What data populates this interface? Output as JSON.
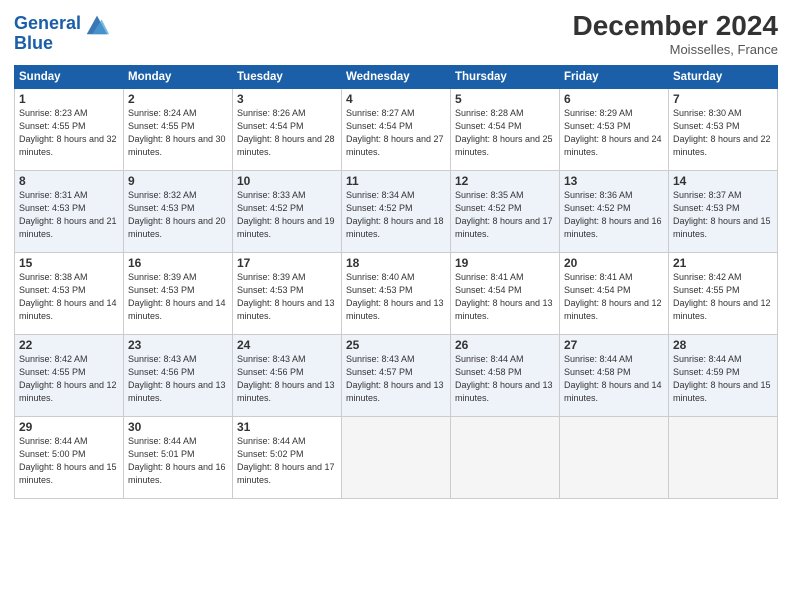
{
  "header": {
    "logo_line1": "General",
    "logo_line2": "Blue",
    "month": "December 2024",
    "location": "Moisselles, France"
  },
  "days_of_week": [
    "Sunday",
    "Monday",
    "Tuesday",
    "Wednesday",
    "Thursday",
    "Friday",
    "Saturday"
  ],
  "weeks": [
    [
      {
        "num": "1",
        "sunrise": "8:23 AM",
        "sunset": "4:55 PM",
        "daylight": "8 hours and 32 minutes."
      },
      {
        "num": "2",
        "sunrise": "8:24 AM",
        "sunset": "4:55 PM",
        "daylight": "8 hours and 30 minutes."
      },
      {
        "num": "3",
        "sunrise": "8:26 AM",
        "sunset": "4:54 PM",
        "daylight": "8 hours and 28 minutes."
      },
      {
        "num": "4",
        "sunrise": "8:27 AM",
        "sunset": "4:54 PM",
        "daylight": "8 hours and 27 minutes."
      },
      {
        "num": "5",
        "sunrise": "8:28 AM",
        "sunset": "4:54 PM",
        "daylight": "8 hours and 25 minutes."
      },
      {
        "num": "6",
        "sunrise": "8:29 AM",
        "sunset": "4:53 PM",
        "daylight": "8 hours and 24 minutes."
      },
      {
        "num": "7",
        "sunrise": "8:30 AM",
        "sunset": "4:53 PM",
        "daylight": "8 hours and 22 minutes."
      }
    ],
    [
      {
        "num": "8",
        "sunrise": "8:31 AM",
        "sunset": "4:53 PM",
        "daylight": "8 hours and 21 minutes."
      },
      {
        "num": "9",
        "sunrise": "8:32 AM",
        "sunset": "4:53 PM",
        "daylight": "8 hours and 20 minutes."
      },
      {
        "num": "10",
        "sunrise": "8:33 AM",
        "sunset": "4:52 PM",
        "daylight": "8 hours and 19 minutes."
      },
      {
        "num": "11",
        "sunrise": "8:34 AM",
        "sunset": "4:52 PM",
        "daylight": "8 hours and 18 minutes."
      },
      {
        "num": "12",
        "sunrise": "8:35 AM",
        "sunset": "4:52 PM",
        "daylight": "8 hours and 17 minutes."
      },
      {
        "num": "13",
        "sunrise": "8:36 AM",
        "sunset": "4:52 PM",
        "daylight": "8 hours and 16 minutes."
      },
      {
        "num": "14",
        "sunrise": "8:37 AM",
        "sunset": "4:53 PM",
        "daylight": "8 hours and 15 minutes."
      }
    ],
    [
      {
        "num": "15",
        "sunrise": "8:38 AM",
        "sunset": "4:53 PM",
        "daylight": "8 hours and 14 minutes."
      },
      {
        "num": "16",
        "sunrise": "8:39 AM",
        "sunset": "4:53 PM",
        "daylight": "8 hours and 14 minutes."
      },
      {
        "num": "17",
        "sunrise": "8:39 AM",
        "sunset": "4:53 PM",
        "daylight": "8 hours and 13 minutes."
      },
      {
        "num": "18",
        "sunrise": "8:40 AM",
        "sunset": "4:53 PM",
        "daylight": "8 hours and 13 minutes."
      },
      {
        "num": "19",
        "sunrise": "8:41 AM",
        "sunset": "4:54 PM",
        "daylight": "8 hours and 13 minutes."
      },
      {
        "num": "20",
        "sunrise": "8:41 AM",
        "sunset": "4:54 PM",
        "daylight": "8 hours and 12 minutes."
      },
      {
        "num": "21",
        "sunrise": "8:42 AM",
        "sunset": "4:55 PM",
        "daylight": "8 hours and 12 minutes."
      }
    ],
    [
      {
        "num": "22",
        "sunrise": "8:42 AM",
        "sunset": "4:55 PM",
        "daylight": "8 hours and 12 minutes."
      },
      {
        "num": "23",
        "sunrise": "8:43 AM",
        "sunset": "4:56 PM",
        "daylight": "8 hours and 13 minutes."
      },
      {
        "num": "24",
        "sunrise": "8:43 AM",
        "sunset": "4:56 PM",
        "daylight": "8 hours and 13 minutes."
      },
      {
        "num": "25",
        "sunrise": "8:43 AM",
        "sunset": "4:57 PM",
        "daylight": "8 hours and 13 minutes."
      },
      {
        "num": "26",
        "sunrise": "8:44 AM",
        "sunset": "4:58 PM",
        "daylight": "8 hours and 13 minutes."
      },
      {
        "num": "27",
        "sunrise": "8:44 AM",
        "sunset": "4:58 PM",
        "daylight": "8 hours and 14 minutes."
      },
      {
        "num": "28",
        "sunrise": "8:44 AM",
        "sunset": "4:59 PM",
        "daylight": "8 hours and 15 minutes."
      }
    ],
    [
      {
        "num": "29",
        "sunrise": "8:44 AM",
        "sunset": "5:00 PM",
        "daylight": "8 hours and 15 minutes."
      },
      {
        "num": "30",
        "sunrise": "8:44 AM",
        "sunset": "5:01 PM",
        "daylight": "8 hours and 16 minutes."
      },
      {
        "num": "31",
        "sunrise": "8:44 AM",
        "sunset": "5:02 PM",
        "daylight": "8 hours and 17 minutes."
      },
      null,
      null,
      null,
      null
    ]
  ]
}
